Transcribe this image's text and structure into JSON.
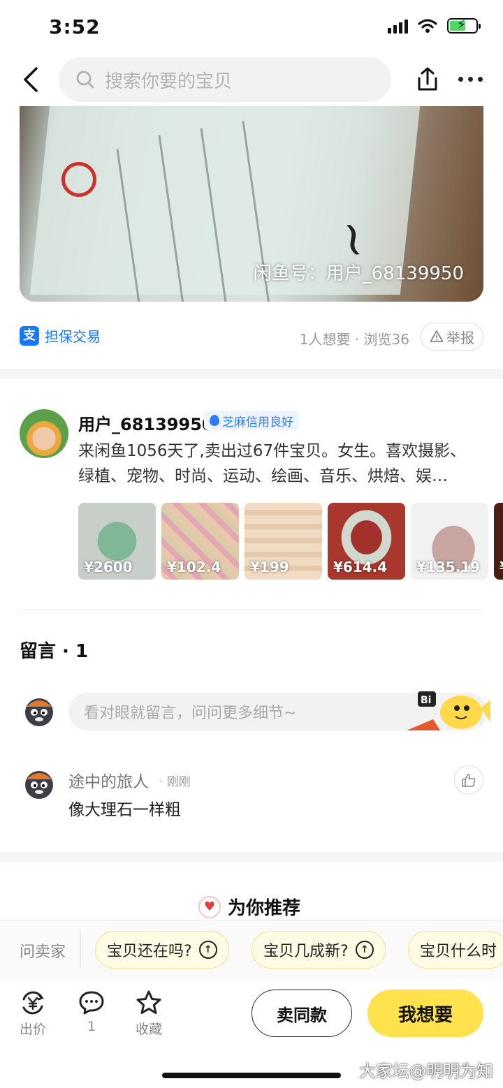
{
  "status": {
    "time": "3:52"
  },
  "nav": {
    "search_placeholder": "搜索你要的宝贝"
  },
  "photo": {
    "watermark": "闲鱼号：用户_68139950"
  },
  "info": {
    "guarantee": "担保交易",
    "stats": "1人想要 · 浏览36",
    "report": "举报"
  },
  "seller": {
    "name": "用户_68139950",
    "badge": "芝麻信用良好",
    "bio": "来闲鱼1056天了,卖出过67件宝贝。女生。喜欢摄影、绿植、宠物、时尚、运动、绘画、音乐、烘焙、娱…",
    "items": [
      {
        "price": "¥2600"
      },
      {
        "price": "¥102.4"
      },
      {
        "price": "¥199"
      },
      {
        "price": "¥614.4"
      },
      {
        "price": "¥135.19"
      },
      {
        "price": "¥"
      }
    ]
  },
  "comments": {
    "title": "留言 · 1",
    "input_placeholder": "看对眼就留言，问问更多细节~",
    "list": [
      {
        "name": "途中的旅人",
        "time": "· 刚刚",
        "text": "像大理石一样粗"
      }
    ]
  },
  "recommend": {
    "title": "为你推荐"
  },
  "ask": {
    "label": "问卖家",
    "chips": [
      "宝贝还在吗?",
      "宝贝几成新?",
      "宝贝什么时"
    ]
  },
  "bottom": {
    "bid": "出价",
    "comment_count": "1",
    "favorite": "收藏",
    "sell_same": "卖同款",
    "want": "我想要"
  },
  "watermark_site": "大家坛@明明为知",
  "colors": {
    "accent": "#ffe24d",
    "link": "#1677ff"
  }
}
